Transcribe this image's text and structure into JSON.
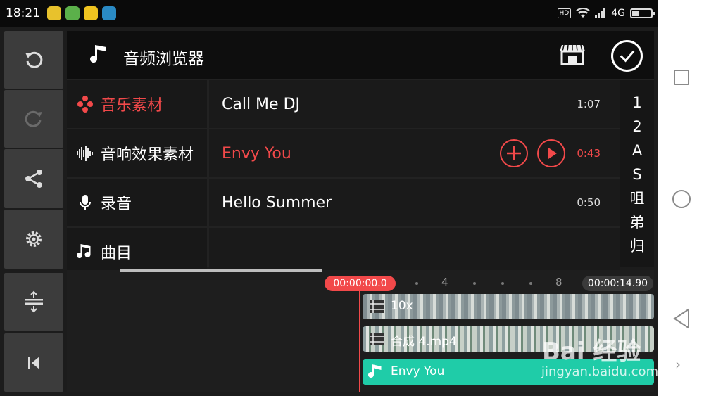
{
  "status_bar": {
    "time": "18:21",
    "network": "4G",
    "hd": "HD"
  },
  "audio_browser": {
    "title": "音频浏览器",
    "categories": [
      {
        "label": "音乐素材",
        "icon": "music-collection-icon",
        "active": true
      },
      {
        "label": "音响效果素材",
        "icon": "waveform-icon",
        "active": false
      },
      {
        "label": "录音",
        "icon": "microphone-icon",
        "active": false
      },
      {
        "label": "曲目",
        "icon": "music-note-icon",
        "active": false
      }
    ],
    "tracks": [
      {
        "name": "Call Me DJ",
        "duration": "1:07",
        "selected": false
      },
      {
        "name": "Envy You",
        "duration": "0:43",
        "selected": true
      },
      {
        "name": "Hello Summer",
        "duration": "0:50",
        "selected": false
      },
      {
        "name": "",
        "duration": "",
        "selected": false
      }
    ],
    "index": [
      "1",
      "2",
      "A",
      "S",
      "咀",
      "弟",
      "归"
    ]
  },
  "timeline": {
    "current_time": "00:00:00.0",
    "total_time": "00:00:14.90",
    "ticks": [
      "4",
      "8"
    ],
    "clips": [
      {
        "label": "10x",
        "icon": "film-icon"
      },
      {
        "label": "合成 4.mp4",
        "icon": "film-icon"
      },
      {
        "label": "Envy You",
        "icon": "music-note-icon"
      }
    ]
  },
  "watermark": {
    "brand": "Bai 经验",
    "url": "jingyan.baidu.com"
  },
  "colors": {
    "accent": "#f2494a",
    "audio_clip": "#1fcca8"
  }
}
